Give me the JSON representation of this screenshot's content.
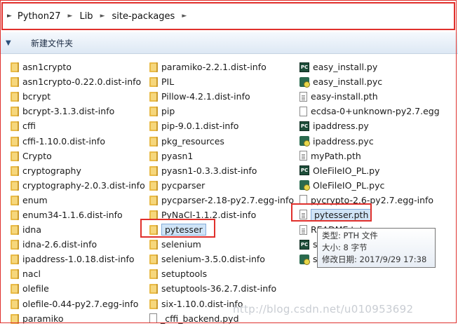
{
  "breadcrumb": [
    "Python27",
    "Lib",
    "site-packages"
  ],
  "toolbar": {
    "new_folder_label": "新建文件夹"
  },
  "column1": [
    {
      "name": "asn1crypto",
      "type": "folder"
    },
    {
      "name": "asn1crypto-0.22.0.dist-info",
      "type": "folder"
    },
    {
      "name": "bcrypt",
      "type": "folder"
    },
    {
      "name": "bcrypt-3.1.3.dist-info",
      "type": "folder"
    },
    {
      "name": "cffi",
      "type": "folder"
    },
    {
      "name": "cffi-1.10.0.dist-info",
      "type": "folder"
    },
    {
      "name": "Crypto",
      "type": "folder"
    },
    {
      "name": "cryptography",
      "type": "folder"
    },
    {
      "name": "cryptography-2.0.3.dist-info",
      "type": "folder"
    },
    {
      "name": "enum",
      "type": "folder"
    },
    {
      "name": "enum34-1.1.6.dist-info",
      "type": "folder"
    },
    {
      "name": "idna",
      "type": "folder"
    },
    {
      "name": "idna-2.6.dist-info",
      "type": "folder"
    },
    {
      "name": "ipaddress-1.0.18.dist-info",
      "type": "folder"
    },
    {
      "name": "nacl",
      "type": "folder"
    },
    {
      "name": "olefile",
      "type": "folder"
    },
    {
      "name": "olefile-0.44-py2.7.egg-info",
      "type": "folder"
    },
    {
      "name": "paramiko",
      "type": "folder"
    }
  ],
  "column2": [
    {
      "name": "paramiko-2.2.1.dist-info",
      "type": "folder"
    },
    {
      "name": "PIL",
      "type": "folder"
    },
    {
      "name": "Pillow-4.2.1.dist-info",
      "type": "folder"
    },
    {
      "name": "pip",
      "type": "folder"
    },
    {
      "name": "pip-9.0.1.dist-info",
      "type": "folder"
    },
    {
      "name": "pkg_resources",
      "type": "folder"
    },
    {
      "name": "pyasn1",
      "type": "folder"
    },
    {
      "name": "pyasn1-0.3.3.dist-info",
      "type": "folder"
    },
    {
      "name": "pycparser",
      "type": "folder"
    },
    {
      "name": "pycparser-2.18-py2.7.egg-info",
      "type": "folder"
    },
    {
      "name": "PyNaCl-1.1.2.dist-info",
      "type": "folder"
    },
    {
      "name": "pytesser",
      "type": "folder",
      "selected": true
    },
    {
      "name": "selenium",
      "type": "folder"
    },
    {
      "name": "selenium-3.5.0.dist-info",
      "type": "folder"
    },
    {
      "name": "setuptools",
      "type": "folder"
    },
    {
      "name": "setuptools-36.2.7.dist-info",
      "type": "folder"
    },
    {
      "name": "six-1.10.0.dist-info",
      "type": "folder"
    },
    {
      "name": "_cffi_backend.pyd",
      "type": "blank"
    }
  ],
  "column3": [
    {
      "name": "easy_install.py",
      "type": "pc"
    },
    {
      "name": "easy_install.pyc",
      "type": "pyc"
    },
    {
      "name": "easy-install.pth",
      "type": "doc"
    },
    {
      "name": "ecdsa-0+unknown-py2.7.egg",
      "type": "blank"
    },
    {
      "name": "ipaddress.py",
      "type": "pc"
    },
    {
      "name": "ipaddress.pyc",
      "type": "pyc"
    },
    {
      "name": "myPath.pth",
      "type": "doc"
    },
    {
      "name": "OleFileIO_PL.py",
      "type": "pc"
    },
    {
      "name": "OleFileIO_PL.pyc",
      "type": "pyc"
    },
    {
      "name": "pycrypto-2.6-py2.7.egg-info",
      "type": "blank"
    },
    {
      "name": "pytesser.pth",
      "type": "doc",
      "selected": true
    },
    {
      "name": "README.txt",
      "type": "doc"
    },
    {
      "name": "si",
      "type": "pc"
    },
    {
      "name": "si",
      "type": "pyc"
    }
  ],
  "tooltip": {
    "type_line": "类型: PTH 文件",
    "size_line": "大小: 8 字节",
    "date_line": "修改日期: 2017/9/29 17:38"
  },
  "watermark": "http://blog.csdn.net/u010953692"
}
